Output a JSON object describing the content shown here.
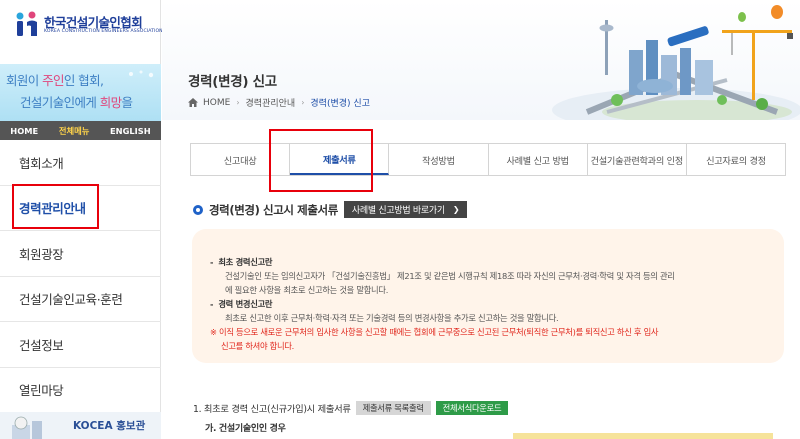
{
  "logo": {
    "name": "한국건설기술인협회",
    "subtitle": "KOREA CONSTRUCTION ENGINEERS ASSOCIATION"
  },
  "banner": {
    "line1_a": "회원이 ",
    "line1_b": "주인",
    "line1_c": "인 협회,",
    "line2_a": "건설기술인에게 ",
    "line2_b": "희망",
    "line2_c": "을"
  },
  "top_menu": [
    "HOME",
    "전체메뉴",
    "ENGLISH"
  ],
  "nav": [
    "협회소개",
    "경력관리안내",
    "회원광장",
    "건설기술인교육·훈련",
    "건설정보",
    "열린마당"
  ],
  "promo": {
    "label": "KOCEA 홍보관"
  },
  "header": {
    "title": "경력(변경) 신고",
    "breadcrumb": [
      "HOME",
      "경력관리안내",
      "경력(변경) 신고"
    ]
  },
  "tabs": [
    "신고대상",
    "제출서류",
    "작성방법",
    "사례별 신고 방법",
    "건설기술관련학과의 인정",
    "신고자료의 경정"
  ],
  "section": {
    "title": "경력(변경) 신고시 제출서류",
    "button": "사례별 신고방법 바로가기"
  },
  "info": {
    "h1": "최초 경력신고란",
    "b1_1": "건설기술인 또는 임의신고자가 「건설기술진흥법」 제21조 및 같은법 시행규칙 제18조 따라 자신의 근무처·경력·학력 및 자격 등의 관리",
    "b1_2": "에 필요한 사항을 최초로 신고하는 것을 말합니다.",
    "h2": "경력 변경신고란",
    "b2_1": "최초로 신고한 이후 근무처·학력·자격 또는 기술경력 등의 변경사항을 추가로 신고하는 것을 말합니다.",
    "w1": "※ 이직 등으로 새로운 근무처의 입사한 사항을 신고할 때에는 협회에 근무중으로 신고된 근무처(퇴직한 근무처)를 퇴직신고 하신 후 입사",
    "w2": "신고를 하셔야 합니다."
  },
  "step1": {
    "label": "1. 최초로 경력 신고(신규가입)시 제출서류",
    "btn_print": "제출서류 목록출력",
    "btn_download": "전체서식다운로드"
  },
  "step1a": {
    "label": "가. 건설기술인인 경우"
  },
  "colors": {
    "accent": "#1f4fa8",
    "highlight": "#e8000b",
    "warning": "#e0271d",
    "green": "#2e9b48"
  }
}
